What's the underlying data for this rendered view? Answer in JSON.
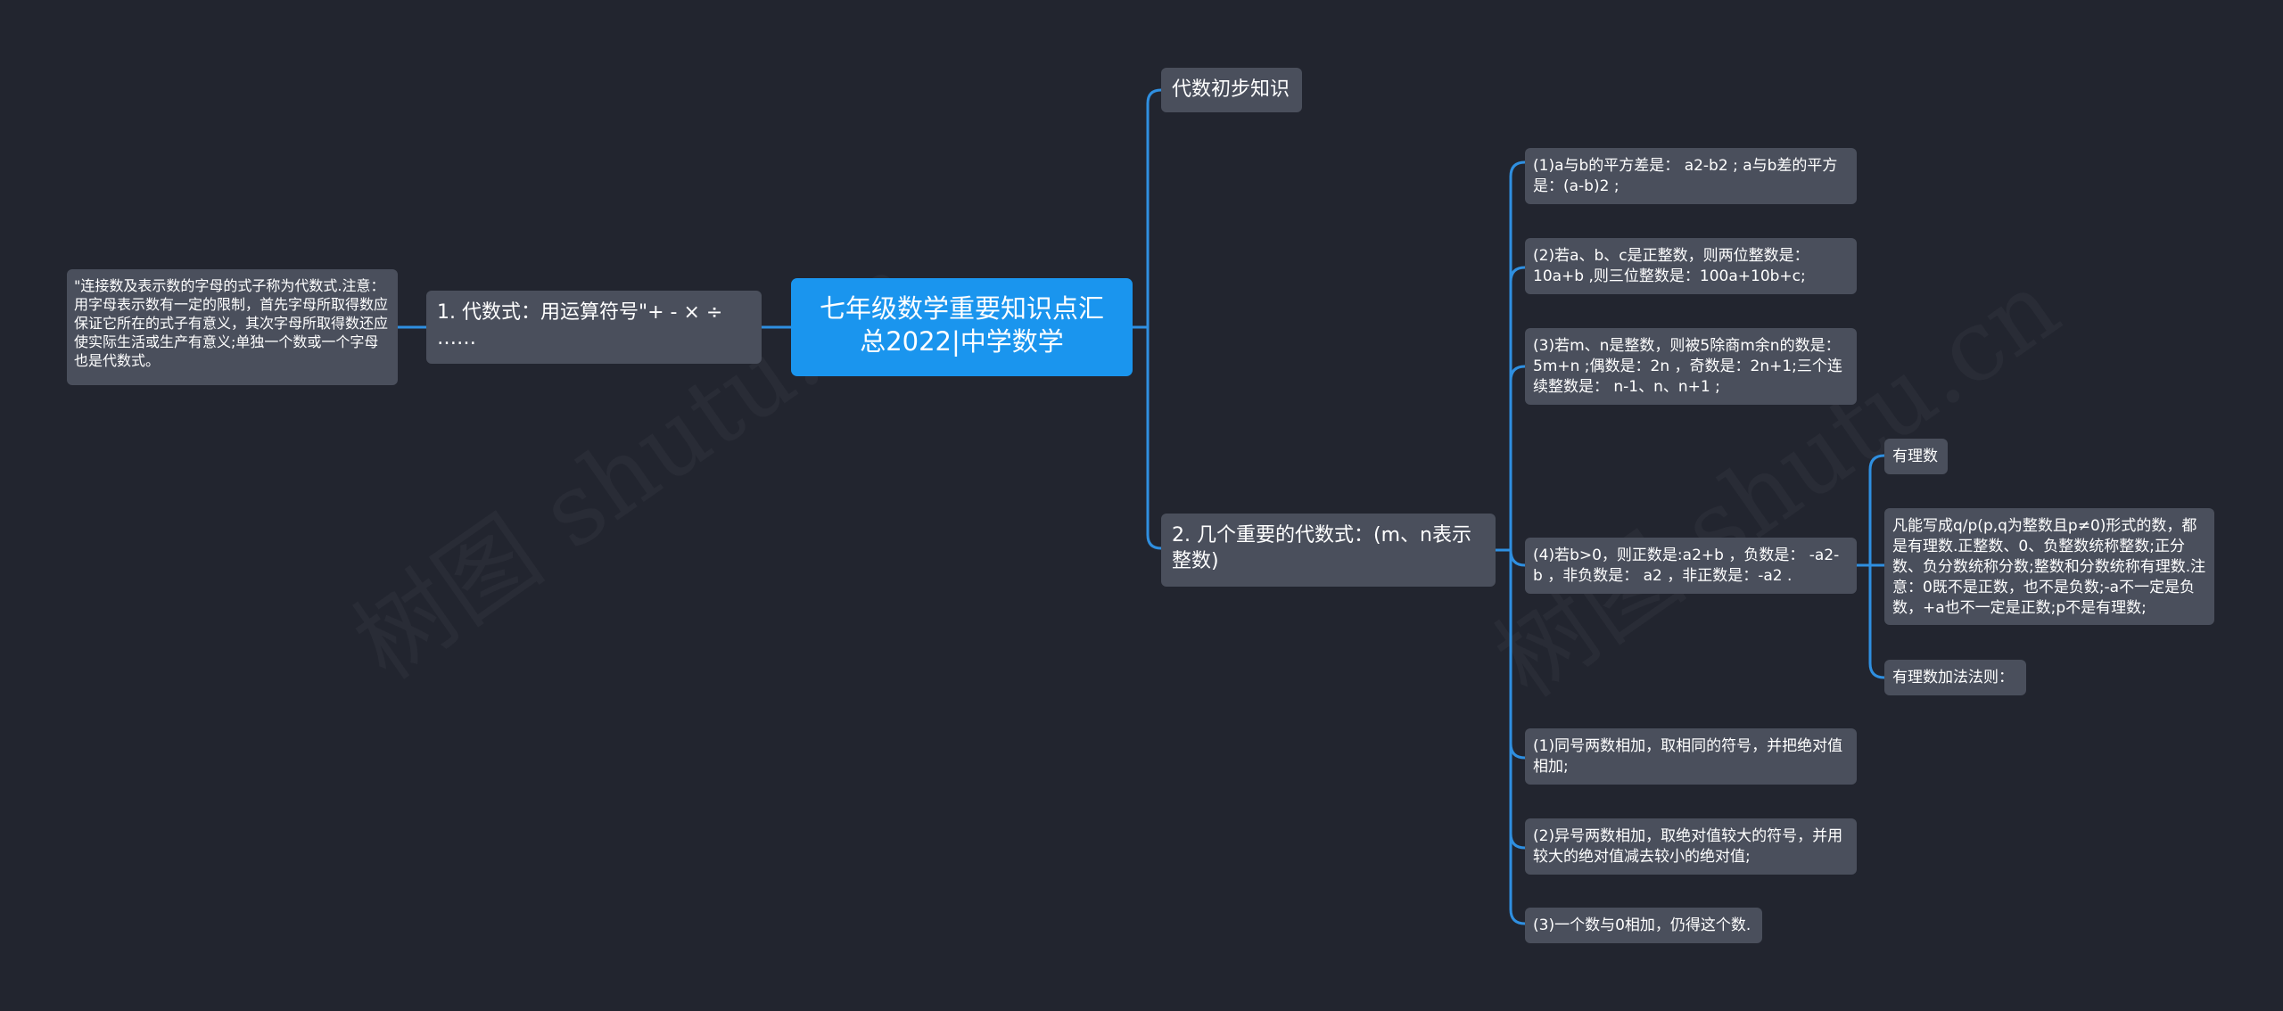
{
  "root": {
    "title": "七年级数学重要知识点汇总2022|中学数学"
  },
  "left": {
    "branch": {
      "label": "1. 代数式：用运算符号\"+ - × ÷ ……"
    },
    "note": {
      "text": "\"连接数及表示数的字母的式子称为代数式.注意：用字母表示数有一定的限制，首先字母所取得数应保证它所在的式子有意义，其次字母所取得数还应使实际生活或生产有意义;单独一个数或一个字母也是代数式。"
    }
  },
  "right": {
    "branches": [
      {
        "label": "代数初步知识"
      },
      {
        "label": "2. 几个重要的代数式：(m、n表示整数)",
        "children": [
          {
            "text": "(1)a与b的平方差是： a2-b2 ; a与b差的平方是：(a-b)2 ;"
          },
          {
            "text": "(2)若a、b、c是正整数，则两位整数是： 10a+b ,则三位整数是：100a+10b+c;"
          },
          {
            "text": "(3)若m、n是整数，则被5除商m余n的数是： 5m+n ;偶数是：2n ，奇数是：2n+1;三个连续整数是： n-1、n、n+1 ;"
          },
          {
            "text": "(4)若b>0，则正数是:a2+b ，负数是： -a2-b ，非负数是： a2 ，非正数是：-a2 .",
            "children": [
              {
                "text": "有理数"
              },
              {
                "text": "凡能写成q/p(p,q为整数且p≠0)形式的数，都是有理数.正整数、0、负整数统称整数;正分数、负分数统称分数;整数和分数统称有理数.注意：0既不是正数，也不是负数;-a不一定是负数，+a也不一定是正数;p不是有理数;"
              },
              {
                "text": "有理数加法法则："
              }
            ]
          },
          {
            "text": "(1)同号两数相加，取相同的符号，并把绝对值相加;"
          },
          {
            "text": "(2)异号两数相加，取绝对值较大的符号，并用较大的绝对值减去较小的绝对值;"
          },
          {
            "text": "(3)一个数与0相加，仍得这个数."
          }
        ]
      }
    ]
  },
  "watermark": {
    "text": "树图 shutu.cn"
  },
  "colors": {
    "background": "#22252f",
    "root": "#1a95ee",
    "node": "#4a4f5c",
    "link": "#2f8fe0",
    "text": "#ffffff"
  }
}
